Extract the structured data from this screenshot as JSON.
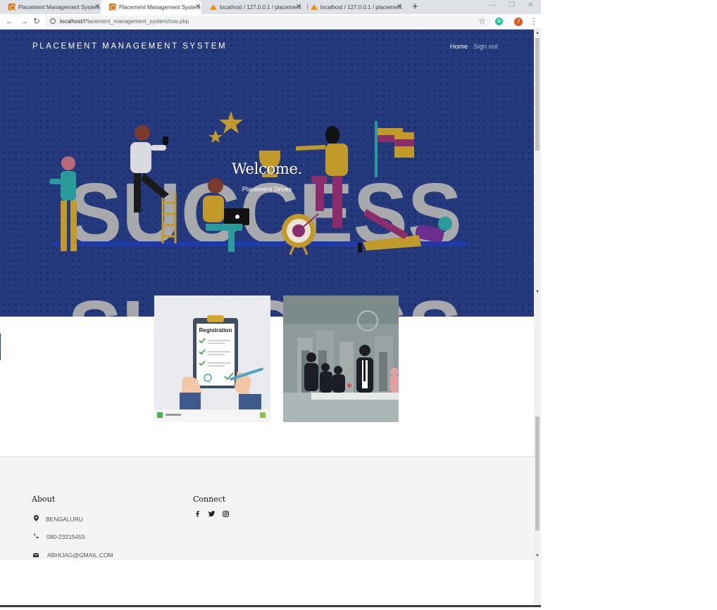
{
  "browser": {
    "tabs": [
      {
        "title": "Placement Management System",
        "favicon": "pms-icon",
        "active": false
      },
      {
        "title": "Placement Management System",
        "favicon": "pms-icon",
        "active": true
      },
      {
        "title": "localhost / 127.0.0.1 / placement",
        "favicon": "phpmyadmin-icon",
        "active": false
      },
      {
        "title": "localhost / 127.0.0.1 / placement",
        "favicon": "phpmyadmin-icon",
        "active": false
      }
    ],
    "url_host": "localhost",
    "url_path": "/Placement_management_system/coe.php",
    "profile_initial": "J",
    "extension_initial": "G"
  },
  "page": {
    "brand": "PLACEMENT MANAGEMENT SYSTEM",
    "nav": {
      "home": "Home",
      "signout": "Sign out"
    },
    "hero": {
      "title": "Welcome.",
      "subtitle": "Placement Drives",
      "art_word": "SUCCESS"
    },
    "cards": {
      "registration_label": "Registration"
    },
    "footer": {
      "about_title": "About",
      "connect_title": "Connect",
      "location": "BENGALURU",
      "phone": "080-23215455",
      "email": "ABHIJAG@GMAIL.COM",
      "social_icons": [
        "facebook-icon",
        "twitter-icon",
        "instagram-icon"
      ]
    }
  },
  "colors": {
    "hero_bg": "#253a7c",
    "letter_gray": "#a7a9ad",
    "accent_mustard": "#c19a2a",
    "accent_magenta": "#8b2d6b",
    "teal": "#2b9a9a",
    "footer_bg": "#f4f4f4"
  }
}
